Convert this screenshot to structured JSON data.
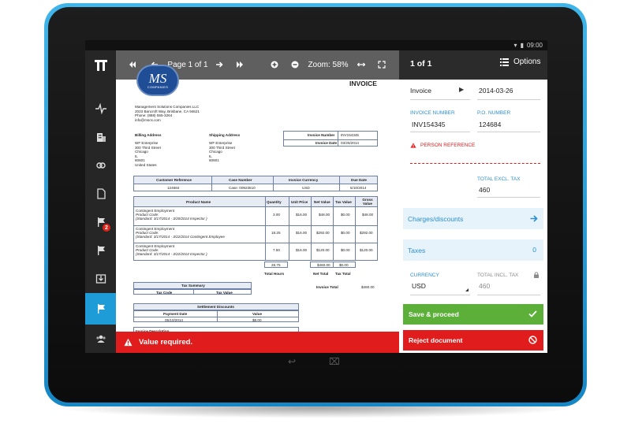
{
  "status_bar": {
    "time": "09:00"
  },
  "app": {
    "logo_text": "T"
  },
  "nav": {
    "badge_count": "2"
  },
  "viewer": {
    "page_label": "Page 1 of 1",
    "zoom_label": "Zoom: 58%"
  },
  "invoice": {
    "logo_text": "MS",
    "logo_sub": "COMPANIES",
    "title": "INVOICE",
    "company_lines": [
      "Management Solutions Companies LLC",
      "2023 Bancroft Way, Brisbane, CA 94621",
      "Phone: (888) 555-3264",
      "info@mscs.com"
    ],
    "billing_title": "Billing Address",
    "billing_lines": [
      "WF Enterprise",
      "300 Third Street",
      "Chicago",
      "IL",
      "60601",
      "United States"
    ],
    "shipping_title": "Shipping Address",
    "shipping_lines": [
      "WF Enterprise",
      "300 Third Street",
      "Chicago",
      "IL",
      "60601"
    ],
    "number_label": "Invoice Number",
    "number_value": "INV154345",
    "date_label": "Invoice Date",
    "date_value": "03/26/2014",
    "ref_headers": [
      "Customer Reference",
      "Case Number",
      "Invoice Currency",
      "Due Date"
    ],
    "ref_values": [
      "124684",
      "Case: 00923510",
      "USD",
      "5/10/2014"
    ],
    "line_headers": [
      "Product Name",
      "Quantity",
      "Unit Price",
      "Net Value",
      "Tax Value",
      "Gross Value"
    ],
    "lines": [
      {
        "name": "Contingent Employment",
        "sub1": "Product Code:",
        "sub2": "(Standard: 3/17/2014 - 3/20/2014 Inspector )",
        "qty": "3.00",
        "price": "$16.00",
        "net": "$48.00",
        "tax": "$0.00",
        "gross": "$48.00"
      },
      {
        "name": "Contingent Employment",
        "sub1": "Product Code:",
        "sub2": "(Standard: 3/17/2014 - 3/22/2014 Contingent Employee",
        "qty": "18.25",
        "price": "$16.00",
        "net": "$292.00",
        "tax": "$0.00",
        "gross": "$292.00"
      },
      {
        "name": "Contingent Employment",
        "sub1": "Product Code:",
        "sub2": "(Standard: 3/17/2014 - 3/22/2014 Inspector )",
        "qty": "7.50",
        "price": "$16.00",
        "net": "$120.00",
        "tax": "$0.00",
        "gross": "$120.00"
      }
    ],
    "total_hours_value": "28.75",
    "total_hours_label": "Total Hours",
    "net_total_value": "$460.00",
    "net_total_label": "Net Total",
    "tax_total_value": "$0.00",
    "tax_total_label": "Tax Total",
    "tax_summary_title": "Tax Summary",
    "tax_summary_headers": [
      "Tax Code",
      "Tax Value"
    ],
    "invoice_total_label": "Invoice Total",
    "invoice_total_value": "$460.00",
    "settlement_title": "Settlement Discounts",
    "settlement_headers": [
      "Payment Date",
      "Value"
    ],
    "settlement_values": [
      "05/10/2014",
      "$8.00"
    ],
    "description_title": "Invoice Description"
  },
  "error_message": "Value required.",
  "panel": {
    "counter": "1 of 1",
    "options_label": "Options",
    "doc_type": "Invoice",
    "doc_date": "2014-03-26",
    "invoice_number_label": "INVOICE NUMBER",
    "invoice_number_value": "INV154345",
    "po_number_label": "P.O. NUMBER",
    "po_number_value": "124684",
    "person_ref_label": "PERSON REFERENCE",
    "total_excl_label": "TOTAL EXCL. TAX",
    "total_excl_value": "460",
    "charges_label": "Charges/discounts",
    "taxes_label": "Taxes",
    "taxes_value": "0",
    "currency_label": "CURRENCY",
    "currency_value": "USD",
    "total_incl_label": "TOTAL INCL. TAX",
    "total_incl_value": "460",
    "save_label": "Save & proceed",
    "reject_label": "Reject document"
  },
  "colors": {
    "accent": "#1e9cd7",
    "error": "#e01c1c",
    "success": "#5cb03a",
    "panel_link_bg": "#e6f3fb"
  }
}
